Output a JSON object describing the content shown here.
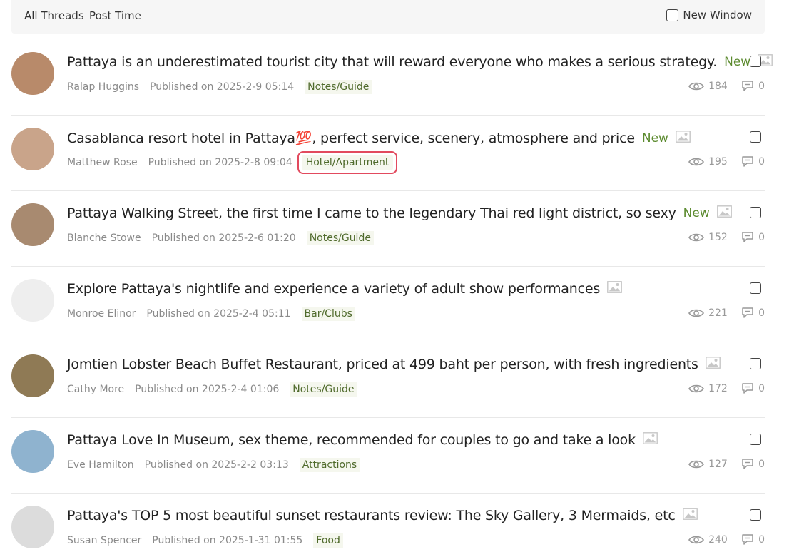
{
  "topbar": {
    "tab_all": "All Threads",
    "tab_post_time": "Post Time",
    "new_window": "New Window"
  },
  "colors": {
    "new_tag": "#5b8a2e",
    "category_bg": "#f5f7ee",
    "category_text": "#4f6a2b",
    "highlight": "#e24a5e"
  },
  "threads": [
    {
      "title": "Pattaya is an underestimated tourist city that will reward everyone who makes a serious strategy.",
      "emoji": "",
      "new": "New",
      "author": "Ralap Huggins",
      "published": "Published on 2025-2-9 05:14",
      "category": "Notes/Guide",
      "views": "184",
      "replies": "0",
      "avatar_color": "#b88a6a"
    },
    {
      "title": "Casablanca resort hotel in Pattaya",
      "emoji": "💯",
      "title_rest": ", perfect service, scenery, atmosphere and price",
      "new": "New",
      "author": "Matthew Rose",
      "published": "Published on 2025-2-8 09:04",
      "category": "Hotel/Apartment",
      "views": "195",
      "replies": "0",
      "avatar_color": "#c9a48a",
      "highlighted": true
    },
    {
      "title": "Pattaya Walking Street, the first time I came to the legendary Thai red light district, so sexy",
      "emoji": "",
      "new": "New",
      "author": "Blanche Stowe",
      "published": "Published on 2025-2-6 01:20",
      "category": "Notes/Guide",
      "views": "152",
      "replies": "0",
      "avatar_color": "#a88a70"
    },
    {
      "title": "Explore Pattaya's nightlife and experience a variety of adult show performances",
      "emoji": "",
      "new": "",
      "author": "Monroe Elinor",
      "published": "Published on 2025-2-4 05:11",
      "category": "Bar/Clubs",
      "views": "221",
      "replies": "0",
      "avatar_color": "#eeeeee"
    },
    {
      "title": "Jomtien Lobster Beach Buffet Restaurant, priced at 499 baht per person, with fresh ingredients",
      "emoji": "",
      "new": "",
      "author": "Cathy More",
      "published": "Published on 2025-2-4 01:06",
      "category": "Notes/Guide",
      "views": "172",
      "replies": "0",
      "avatar_color": "#8f7a55"
    },
    {
      "title": "Pattaya Love In Museum, sex theme, recommended for couples to go and take a look",
      "emoji": "",
      "new": "",
      "author": "Eve Hamilton",
      "published": "Published on 2025-2-2 03:13",
      "category": "Attractions",
      "views": "127",
      "replies": "0",
      "avatar_color": "#8fb3cf"
    },
    {
      "title": "Pattaya's TOP 5 most beautiful sunset restaurants review: The Sky Gallery, 3 Mermaids, etc",
      "emoji": "",
      "new": "",
      "author": "Susan Spencer",
      "published": "Published on 2025-1-31 01:55",
      "category": "Food",
      "views": "240",
      "replies": "0",
      "avatar_color": "#dcdcdc"
    }
  ]
}
